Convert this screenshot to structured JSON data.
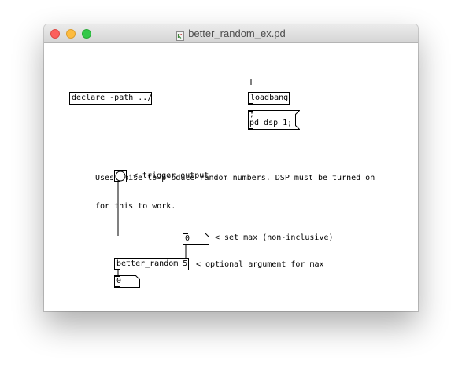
{
  "window": {
    "title": "better_random_ex.pd"
  },
  "objects": {
    "declare": "declare -path ../",
    "loadbang": "loadbang",
    "dsp_message": "; pd dsp 1;",
    "dsp_message_line1": ";",
    "dsp_message_line2": "pd dsp 1;",
    "better_random": "better_random 5"
  },
  "number_boxes": {
    "max_value": "0",
    "output_value": "0"
  },
  "comments": {
    "description_line1": "Uses noise to produce random numbers. DSP must be turned on",
    "description_line2": "for this to work.",
    "trigger": "< trigger output",
    "set_max": "< set max (non-inclusive)",
    "optional_arg": "< optional argument for max"
  },
  "icons": {
    "document": "pd-document-icon",
    "bang": "bang-icon"
  },
  "colors": {
    "close": "#fc605c",
    "minimize": "#fdbc40",
    "zoom": "#34c84a",
    "ink": "#000000",
    "canvas": "#ffffff"
  }
}
